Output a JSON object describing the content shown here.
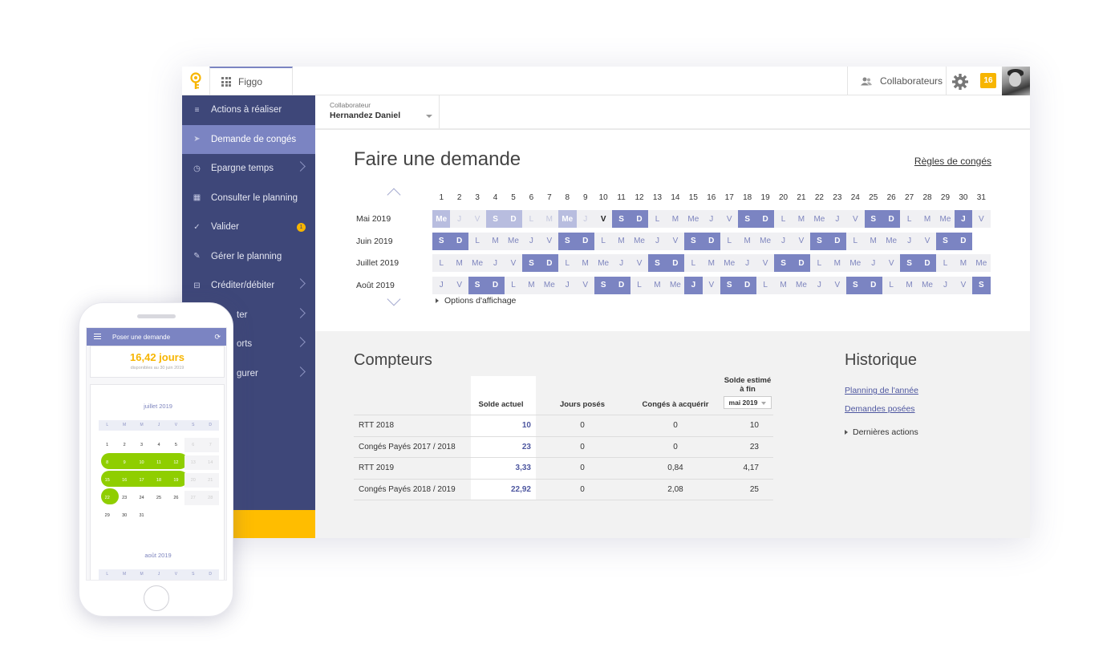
{
  "topbar": {
    "app_name": "Figgo",
    "collaborators_label": "Collaborateurs",
    "notification_count": "16"
  },
  "sidebar": {
    "items": [
      {
        "label": "Actions à réaliser",
        "icon": "list-check-icon",
        "chevron": false
      },
      {
        "label": "Demande de congés",
        "icon": "paper-plane-icon",
        "chevron": false,
        "active": true
      },
      {
        "label": "Epargne temps",
        "icon": "clock-icon",
        "chevron": true
      },
      {
        "label": "Consulter le planning",
        "icon": "calendar-icon",
        "chevron": false
      },
      {
        "label": "Valider",
        "icon": "checkmark-icon",
        "chevron": false,
        "badge": "1"
      },
      {
        "label": "Gérer le planning",
        "icon": "calendar-edit-icon",
        "chevron": false
      },
      {
        "label": "Créditer/débiter",
        "icon": "balance-icon",
        "chevron": true
      },
      {
        "label": "ter",
        "icon": "",
        "chevron": true
      },
      {
        "label": "orts",
        "icon": "",
        "chevron": true
      },
      {
        "label": "gurer",
        "icon": "",
        "chevron": true
      }
    ]
  },
  "collaborator_select": {
    "label": "Collaborateur",
    "value": "Hernandez Daniel"
  },
  "request": {
    "title": "Faire une demande",
    "rules_link": "Règles de congés",
    "options_label": "Options d'affichage"
  },
  "calendar": {
    "day_numbers": [
      "1",
      "2",
      "3",
      "4",
      "5",
      "6",
      "7",
      "8",
      "9",
      "10",
      "11",
      "12",
      "13",
      "14",
      "15",
      "16",
      "17",
      "18",
      "19",
      "20",
      "21",
      "22",
      "23",
      "24",
      "25",
      "26",
      "27",
      "28",
      "29",
      "30",
      "31"
    ],
    "months": [
      {
        "name": "Mai 2019",
        "days": [
          {
            "t": "Me",
            "s": "wedim"
          },
          {
            "t": "J",
            "s": "dim"
          },
          {
            "t": "V",
            "s": "dim"
          },
          {
            "t": "S",
            "s": "wedim"
          },
          {
            "t": "D",
            "s": "wedim"
          },
          {
            "t": "L",
            "s": "dim"
          },
          {
            "t": "M",
            "s": "dim"
          },
          {
            "t": "Me",
            "s": "wedim"
          },
          {
            "t": "J",
            "s": "dim"
          },
          {
            "t": "V",
            "s": "cur"
          },
          {
            "t": "S",
            "s": "we"
          },
          {
            "t": "D",
            "s": "we"
          },
          {
            "t": "L",
            "s": ""
          },
          {
            "t": "M",
            "s": ""
          },
          {
            "t": "Me",
            "s": ""
          },
          {
            "t": "J",
            "s": ""
          },
          {
            "t": "V",
            "s": ""
          },
          {
            "t": "S",
            "s": "we"
          },
          {
            "t": "D",
            "s": "we"
          },
          {
            "t": "L",
            "s": ""
          },
          {
            "t": "M",
            "s": ""
          },
          {
            "t": "Me",
            "s": ""
          },
          {
            "t": "J",
            "s": ""
          },
          {
            "t": "V",
            "s": ""
          },
          {
            "t": "S",
            "s": "we"
          },
          {
            "t": "D",
            "s": "we"
          },
          {
            "t": "L",
            "s": ""
          },
          {
            "t": "M",
            "s": ""
          },
          {
            "t": "Me",
            "s": ""
          },
          {
            "t": "J",
            "s": "we"
          },
          {
            "t": "V",
            "s": ""
          }
        ]
      },
      {
        "name": "Juin 2019",
        "days": [
          {
            "t": "S",
            "s": "we"
          },
          {
            "t": "D",
            "s": "we"
          },
          {
            "t": "L",
            "s": ""
          },
          {
            "t": "M",
            "s": ""
          },
          {
            "t": "Me",
            "s": ""
          },
          {
            "t": "J",
            "s": ""
          },
          {
            "t": "V",
            "s": ""
          },
          {
            "t": "S",
            "s": "we"
          },
          {
            "t": "D",
            "s": "we"
          },
          {
            "t": "L",
            "s": ""
          },
          {
            "t": "M",
            "s": ""
          },
          {
            "t": "Me",
            "s": ""
          },
          {
            "t": "J",
            "s": ""
          },
          {
            "t": "V",
            "s": ""
          },
          {
            "t": "S",
            "s": "we"
          },
          {
            "t": "D",
            "s": "we"
          },
          {
            "t": "L",
            "s": ""
          },
          {
            "t": "M",
            "s": ""
          },
          {
            "t": "Me",
            "s": ""
          },
          {
            "t": "J",
            "s": ""
          },
          {
            "t": "V",
            "s": ""
          },
          {
            "t": "S",
            "s": "we"
          },
          {
            "t": "D",
            "s": "we"
          },
          {
            "t": "L",
            "s": ""
          },
          {
            "t": "M",
            "s": ""
          },
          {
            "t": "Me",
            "s": ""
          },
          {
            "t": "J",
            "s": ""
          },
          {
            "t": "V",
            "s": ""
          },
          {
            "t": "S",
            "s": "we"
          },
          {
            "t": "D",
            "s": "we"
          }
        ]
      },
      {
        "name": "Juillet 2019",
        "days": [
          {
            "t": "L",
            "s": ""
          },
          {
            "t": "M",
            "s": ""
          },
          {
            "t": "Me",
            "s": ""
          },
          {
            "t": "J",
            "s": ""
          },
          {
            "t": "V",
            "s": ""
          },
          {
            "t": "S",
            "s": "we"
          },
          {
            "t": "D",
            "s": "we"
          },
          {
            "t": "L",
            "s": ""
          },
          {
            "t": "M",
            "s": ""
          },
          {
            "t": "Me",
            "s": ""
          },
          {
            "t": "J",
            "s": ""
          },
          {
            "t": "V",
            "s": ""
          },
          {
            "t": "S",
            "s": "we"
          },
          {
            "t": "D",
            "s": "we"
          },
          {
            "t": "L",
            "s": ""
          },
          {
            "t": "M",
            "s": ""
          },
          {
            "t": "Me",
            "s": ""
          },
          {
            "t": "J",
            "s": ""
          },
          {
            "t": "V",
            "s": ""
          },
          {
            "t": "S",
            "s": "we"
          },
          {
            "t": "D",
            "s": "we"
          },
          {
            "t": "L",
            "s": ""
          },
          {
            "t": "M",
            "s": ""
          },
          {
            "t": "Me",
            "s": ""
          },
          {
            "t": "J",
            "s": ""
          },
          {
            "t": "V",
            "s": ""
          },
          {
            "t": "S",
            "s": "we"
          },
          {
            "t": "D",
            "s": "we"
          },
          {
            "t": "L",
            "s": ""
          },
          {
            "t": "M",
            "s": ""
          },
          {
            "t": "Me",
            "s": ""
          }
        ]
      },
      {
        "name": "Août 2019",
        "days": [
          {
            "t": "J",
            "s": ""
          },
          {
            "t": "V",
            "s": ""
          },
          {
            "t": "S",
            "s": "we"
          },
          {
            "t": "D",
            "s": "we"
          },
          {
            "t": "L",
            "s": ""
          },
          {
            "t": "M",
            "s": ""
          },
          {
            "t": "Me",
            "s": ""
          },
          {
            "t": "J",
            "s": ""
          },
          {
            "t": "V",
            "s": ""
          },
          {
            "t": "S",
            "s": "we"
          },
          {
            "t": "D",
            "s": "we"
          },
          {
            "t": "L",
            "s": ""
          },
          {
            "t": "M",
            "s": ""
          },
          {
            "t": "Me",
            "s": ""
          },
          {
            "t": "J",
            "s": "we"
          },
          {
            "t": "V",
            "s": ""
          },
          {
            "t": "S",
            "s": "we"
          },
          {
            "t": "D",
            "s": "we"
          },
          {
            "t": "L",
            "s": ""
          },
          {
            "t": "M",
            "s": ""
          },
          {
            "t": "Me",
            "s": ""
          },
          {
            "t": "J",
            "s": ""
          },
          {
            "t": "V",
            "s": ""
          },
          {
            "t": "S",
            "s": "we"
          },
          {
            "t": "D",
            "s": "we"
          },
          {
            "t": "L",
            "s": ""
          },
          {
            "t": "M",
            "s": ""
          },
          {
            "t": "Me",
            "s": ""
          },
          {
            "t": "J",
            "s": ""
          },
          {
            "t": "V",
            "s": ""
          },
          {
            "t": "S",
            "s": "we"
          }
        ]
      }
    ]
  },
  "counters": {
    "title": "Compteurs",
    "headers": [
      "",
      "Solde actuel",
      "Jours posés",
      "Congés à acquérir",
      "Solde estimé à fin"
    ],
    "period_select": "mai 2019",
    "rows": [
      [
        "RTT 2018",
        "10",
        "0",
        "0",
        "10"
      ],
      [
        "Congés Payés 2017 / 2018",
        "23",
        "0",
        "0",
        "23"
      ],
      [
        "RTT 2019",
        "3,33",
        "0",
        "0,84",
        "4,17"
      ],
      [
        "Congés Payés 2018 / 2019",
        "22,92",
        "0",
        "2,08",
        "25"
      ]
    ]
  },
  "history": {
    "title": "Historique",
    "links": [
      "Planning de l'année",
      "Demandes posées"
    ],
    "last_actions": "Dernières actions"
  },
  "phone": {
    "header_title": "Poser une demande",
    "balance": "16,42 jours",
    "balance_sub": "disponibles au 30 juin 2019",
    "month1": "juillet 2019",
    "month2": "août 2019",
    "weekdays": [
      "L",
      "M",
      "M",
      "J",
      "V",
      "S",
      "D"
    ],
    "weeks": [
      [
        "1",
        "2",
        "3",
        "4",
        "5",
        "6",
        "7"
      ],
      [
        "8",
        "9",
        "10",
        "11",
        "12",
        "13",
        "14"
      ],
      [
        "15",
        "16",
        "17",
        "18",
        "19",
        "20",
        "21"
      ],
      [
        "22",
        "23",
        "24",
        "25",
        "26",
        "27",
        "28"
      ],
      [
        "29",
        "30",
        "31",
        "",
        "",
        "",
        ""
      ]
    ]
  }
}
